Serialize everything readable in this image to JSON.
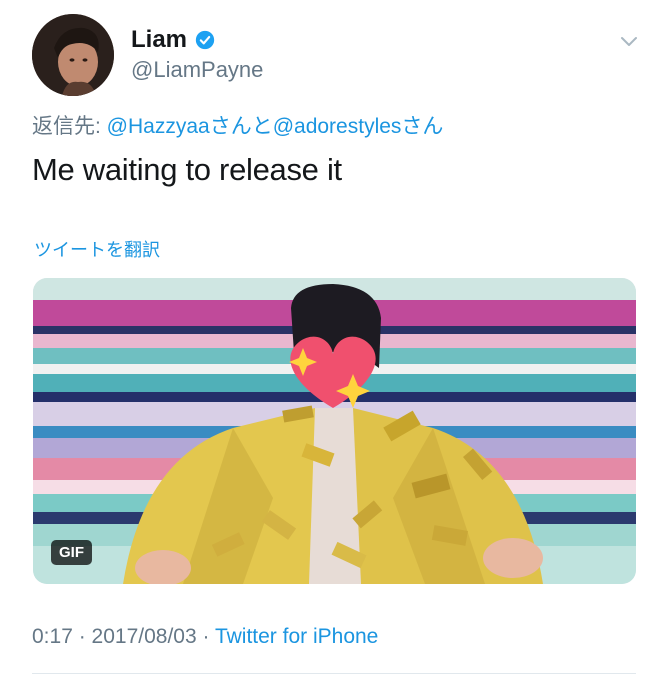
{
  "user": {
    "display_name": "Liam",
    "handle": "@LiamPayne",
    "verified": true
  },
  "reply": {
    "prefix": "返信先: ",
    "mention1": "@Hazzyaa",
    "san1": "さんと",
    "mention2": "@adorestyles",
    "san2": "さん"
  },
  "tweet": {
    "text": "Me waiting to release it",
    "translate_label": "ツイートを翻訳"
  },
  "media": {
    "type_badge": "GIF"
  },
  "meta": {
    "time": "0:17",
    "sep1": " · ",
    "date": "2017/08/03",
    "sep2": " · ",
    "source": "Twitter for iPhone"
  },
  "colors": {
    "link": "#1b95e0",
    "secondary": "#657786",
    "verified": "#1da1f2",
    "jacket": "#e6c84a",
    "heart": "#f0506e"
  },
  "icons": {
    "verified": "verified-badge-icon",
    "more": "chevron-down-icon",
    "censor": "sparkling-heart-icon"
  }
}
